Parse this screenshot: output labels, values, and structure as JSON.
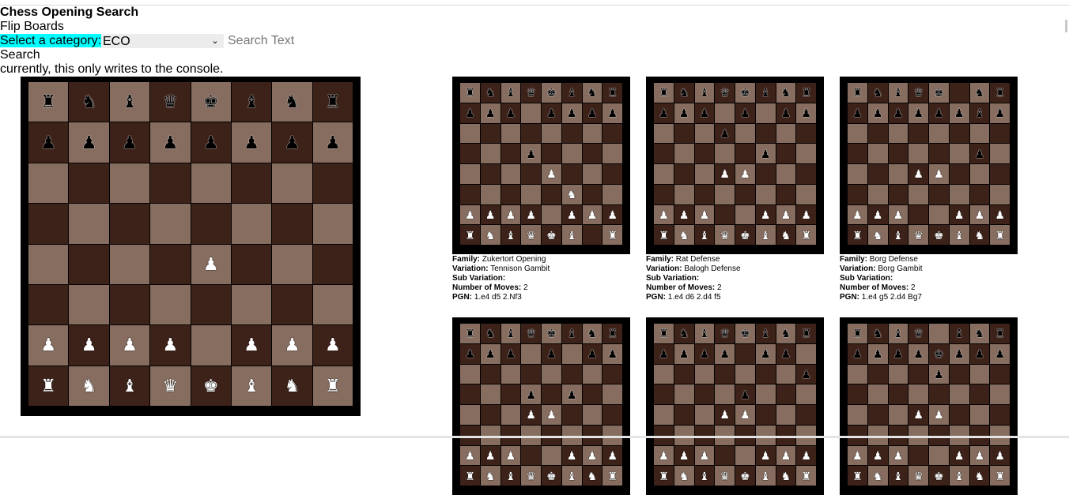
{
  "header": {
    "title": "Chess Opening Search",
    "flip_boards": "Flip Boards",
    "category_label": "Select a category:",
    "category_value": "ECO",
    "search_placeholder": "Search Text",
    "search_button": "Search",
    "console_note": "currently, this only writes to the console."
  },
  "info_labels": {
    "family": "Family:",
    "variation": "Variation:",
    "sub_variation": "Sub Variation:",
    "moves": "Number of Moves:",
    "pgn": "PGN:"
  },
  "colors": {
    "light_square": "#876d5f",
    "dark_square": "#3d2219",
    "highlight": "#00ffff"
  },
  "main_board": {
    "fen": "rnbqkbnr/pppppppp/8/8/4P3/8/PPPP1PPP/RNBQKBNR"
  },
  "openings": [
    {
      "family": "Zukertort Opening",
      "variation": "Tennison Gambit",
      "sub_variation": "",
      "moves": "2",
      "pgn": "1.e4 d5 2.Nf3",
      "fen": "rnbqkbnr/ppp1pppp/8/3p4/4P3/5N2/PPPP1PPP/RNBQKB1R"
    },
    {
      "family": "Rat Defense",
      "variation": "Balogh Defense",
      "sub_variation": "",
      "moves": "2",
      "pgn": "1.e4 d6 2.d4 f5",
      "fen": "rnbqkbnr/ppp1p1pp/3p4/5p2/3PP3/8/PPP2PPP/RNBQKBNR"
    },
    {
      "family": "Borg Defense",
      "variation": "Borg Gambit",
      "sub_variation": "",
      "moves": "2",
      "pgn": "1.e4 g5 2.d4 Bg7",
      "fen": "rnbqk1nr/ppppppbp/8/6p1/3PP3/8/PPP2PPP/RNBQKBNR"
    },
    {
      "family": "",
      "variation": "",
      "sub_variation": "",
      "moves": "",
      "pgn": "",
      "fen": "rnbqkbnr/ppp1p1pp/8/3p1p2/3PP3/8/PPP2PPP/RNBQKBNR"
    },
    {
      "family": "",
      "variation": "",
      "sub_variation": "",
      "moves": "",
      "pgn": "",
      "fen": "rnbqkbnr/pppp1pp1/7p/4p3/3PP3/8/PPP2PPP/RNBQKBNR"
    },
    {
      "family": "",
      "variation": "",
      "sub_variation": "",
      "moves": "",
      "pgn": "",
      "fen": "rnbq1bnr/ppppkppp/4p3/8/3PP3/8/PPP2PPP/RNBQKBNR"
    }
  ]
}
